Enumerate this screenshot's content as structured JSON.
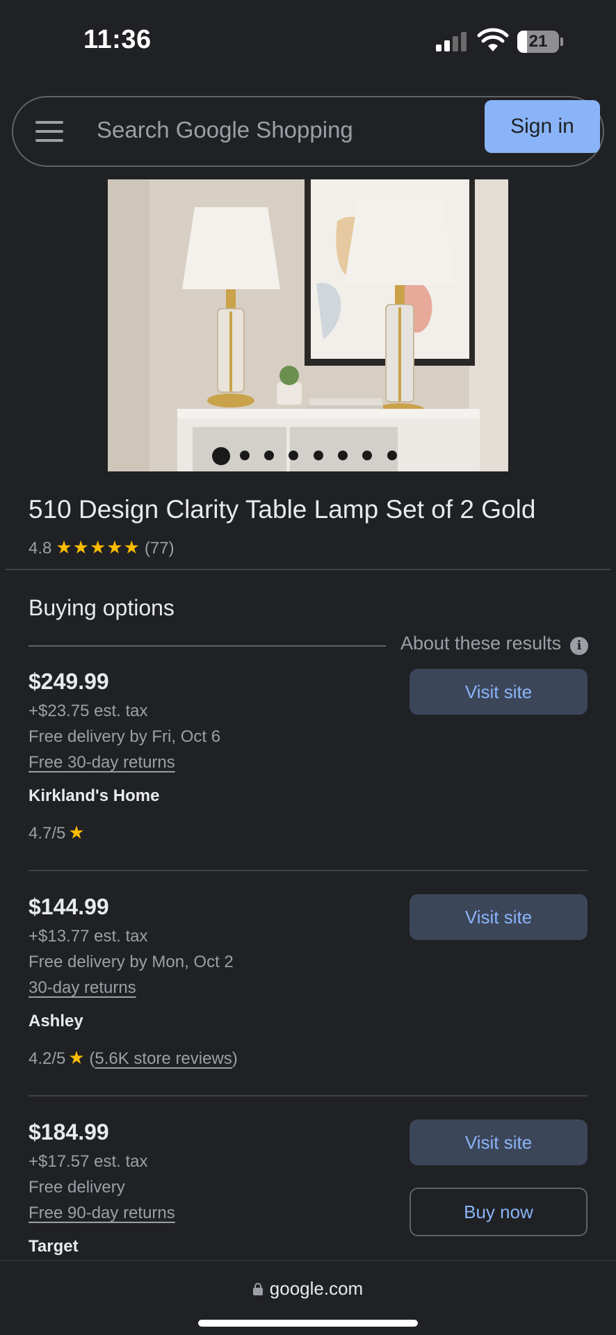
{
  "status_bar": {
    "time": "11:36",
    "battery": "21"
  },
  "search": {
    "placeholder": "Search Google Shopping",
    "sign_in_label": "Sign in"
  },
  "product": {
    "title": "510 Design Clarity Table Lamp Set of 2 Gold",
    "rating": "4.8",
    "stars": "★★★★★",
    "review_count": "(77)",
    "image_count": 8,
    "active_image": 1
  },
  "buying": {
    "title": "Buying options",
    "about_label": "About these results"
  },
  "offers": [
    {
      "price": "$249.99",
      "tax": "+$23.75 est. tax",
      "delivery": "Free delivery by Fri, Oct 6",
      "returns": "Free 30-day returns",
      "seller": "Kirkland's Home",
      "seller_rating": "4.7/5",
      "visit_label": "Visit site"
    },
    {
      "price": "$144.99",
      "tax": "+$13.77 est. tax",
      "delivery": "Free delivery by Mon, Oct 2",
      "returns": "30-day returns",
      "seller": "Ashley",
      "seller_rating": "4.2/5",
      "store_reviews": "5.6K store reviews",
      "visit_label": "Visit site"
    },
    {
      "price": "$184.99",
      "tax": "+$17.57 est. tax",
      "delivery": "Free delivery",
      "returns": "Free 90-day returns",
      "seller": "Target",
      "visit_label": "Visit site",
      "buy_label": "Buy now"
    }
  ],
  "footer": {
    "url": "google.com"
  },
  "colors": {
    "background": "#202124",
    "accent": "#8ab4f8",
    "star": "#fbbc04",
    "button_bg": "#3c4659"
  }
}
